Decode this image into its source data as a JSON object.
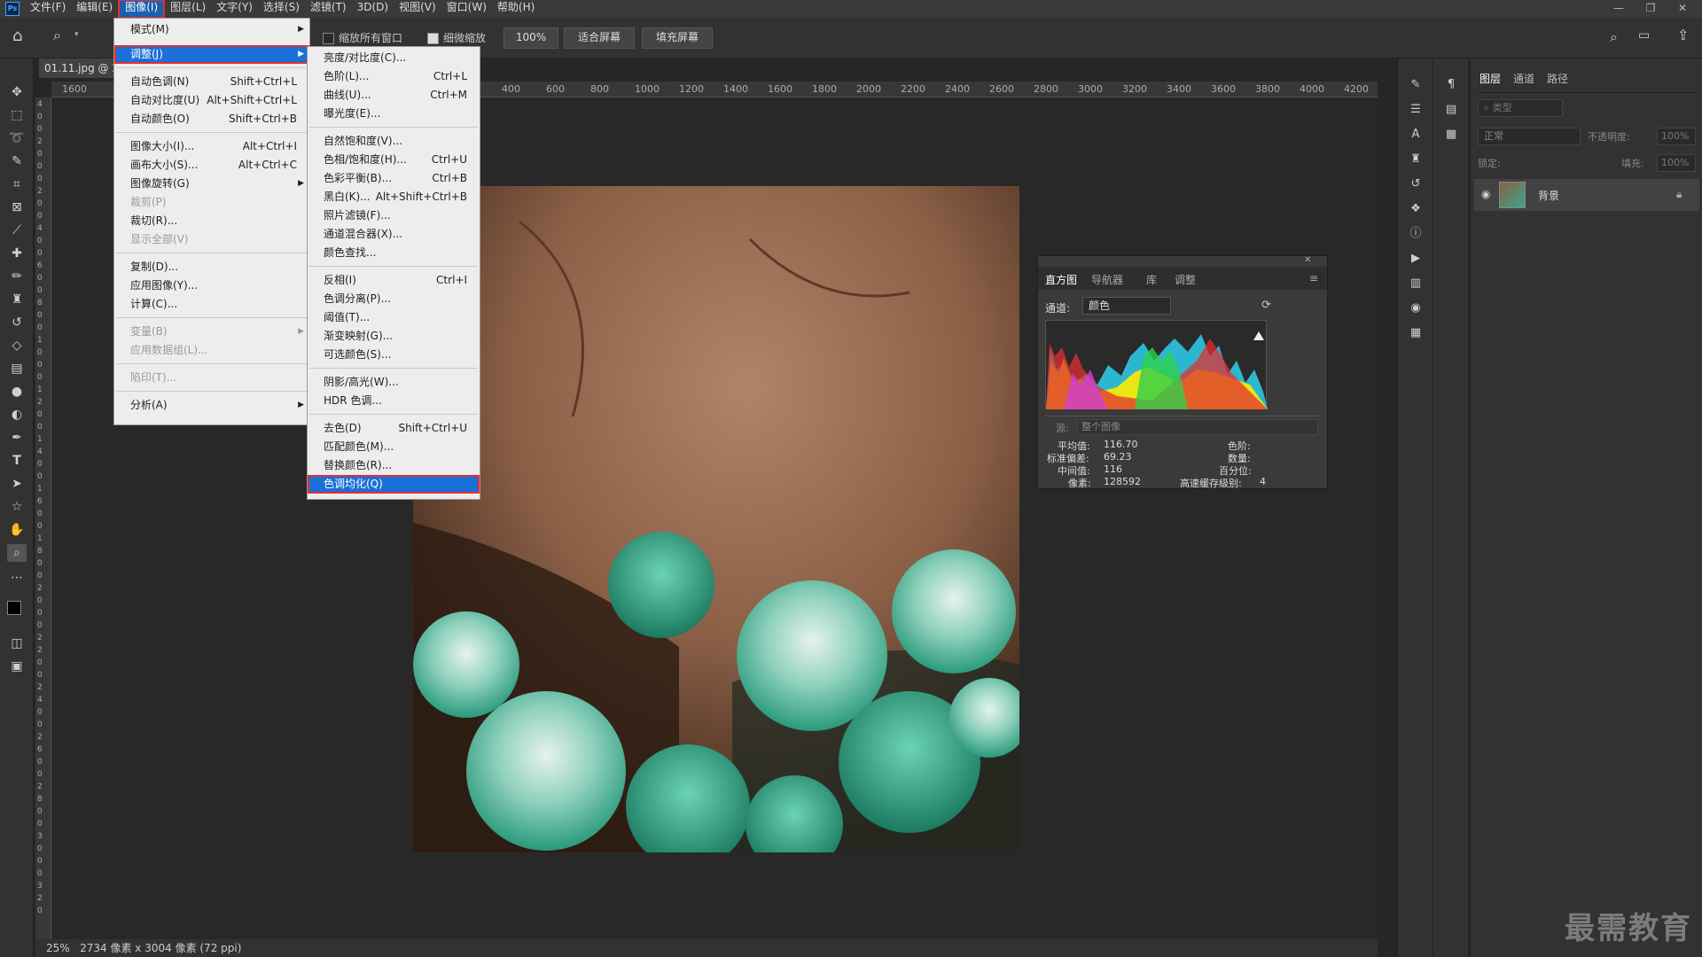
{
  "menubar": {
    "logo": "Ps",
    "items": [
      "文件(F)",
      "编辑(E)",
      "图像(I)",
      "图层(L)",
      "文字(Y)",
      "选择(S)",
      "滤镜(T)",
      "3D(D)",
      "视图(V)",
      "窗口(W)",
      "帮助(H)"
    ],
    "window_controls": [
      "—",
      "❐",
      "✕"
    ]
  },
  "options": {
    "zoom_all": "缩放所有窗口",
    "scrubby": "细微缩放",
    "zoom_100": "100%",
    "fit_screen": "适合屏幕",
    "fill_screen": "填充屏幕"
  },
  "document": {
    "tab": "01.11.jpg @ 2"
  },
  "ruler": {
    "h_ticks": [
      "1600",
      "1",
      "400",
      "600",
      "800",
      "1000",
      "1200",
      "1400",
      "1600",
      "1800",
      "2000",
      "2200",
      "2400",
      "2600",
      "2800",
      "3000",
      "3200",
      "3400",
      "3600",
      "3800",
      "4000",
      "4200"
    ],
    "v_ticks": [
      "4",
      "0",
      "0",
      "2",
      "0",
      "0",
      "0",
      "2",
      "0",
      "0",
      "4",
      "0",
      "0",
      "6",
      "0",
      "0",
      "8",
      "0",
      "0",
      "1",
      "0",
      "0",
      "0",
      "1",
      "2",
      "0",
      "0",
      "1",
      "4",
      "0",
      "0",
      "1",
      "6",
      "0",
      "0",
      "1",
      "8",
      "0",
      "0",
      "2",
      "0",
      "0",
      "0",
      "2",
      "2",
      "0",
      "0",
      "2",
      "4",
      "0",
      "0",
      "2",
      "6",
      "0",
      "0",
      "2",
      "8",
      "0",
      "0",
      "3",
      "0",
      "0",
      "0",
      "3",
      "2",
      "0"
    ]
  },
  "status": {
    "zoom": "25%",
    "info": "2734 像素 x 3004 像素 (72 ppi)"
  },
  "image_menu": [
    {
      "label": "模式(M)",
      "shortcut": "",
      "arrow": true,
      "disabled": false
    },
    {
      "label": "调整(J)",
      "shortcut": "",
      "arrow": true,
      "disabled": false,
      "highlight": true
    },
    {
      "label": "自动色调(N)",
      "shortcut": "Shift+Ctrl+L",
      "arrow": false,
      "disabled": false
    },
    {
      "label": "自动对比度(U)",
      "shortcut": "Alt+Shift+Ctrl+L",
      "arrow": false,
      "disabled": false
    },
    {
      "label": "自动颜色(O)",
      "shortcut": "Shift+Ctrl+B",
      "arrow": false,
      "disabled": false
    },
    {
      "label": "图像大小(I)...",
      "shortcut": "Alt+Ctrl+I",
      "arrow": false,
      "disabled": false
    },
    {
      "label": "画布大小(S)...",
      "shortcut": "Alt+Ctrl+C",
      "arrow": false,
      "disabled": false
    },
    {
      "label": "图像旋转(G)",
      "shortcut": "",
      "arrow": true,
      "disabled": false
    },
    {
      "label": "裁剪(P)",
      "shortcut": "",
      "arrow": false,
      "disabled": true
    },
    {
      "label": "裁切(R)...",
      "shortcut": "",
      "arrow": false,
      "disabled": false
    },
    {
      "label": "显示全部(V)",
      "shortcut": "",
      "arrow": false,
      "disabled": true
    },
    {
      "label": "复制(D)...",
      "shortcut": "",
      "arrow": false,
      "disabled": false
    },
    {
      "label": "应用图像(Y)...",
      "shortcut": "",
      "arrow": false,
      "disabled": false
    },
    {
      "label": "计算(C)...",
      "shortcut": "",
      "arrow": false,
      "disabled": false
    },
    {
      "label": "变量(B)",
      "shortcut": "",
      "arrow": true,
      "disabled": true
    },
    {
      "label": "应用数据组(L)...",
      "shortcut": "",
      "arrow": false,
      "disabled": true
    },
    {
      "label": "陷印(T)...",
      "shortcut": "",
      "arrow": false,
      "disabled": true
    },
    {
      "label": "分析(A)",
      "shortcut": "",
      "arrow": true,
      "disabled": false
    }
  ],
  "adjust_menu": [
    {
      "label": "亮度/对比度(C)...",
      "shortcut": ""
    },
    {
      "label": "色阶(L)...",
      "shortcut": "Ctrl+L"
    },
    {
      "label": "曲线(U)...",
      "shortcut": "Ctrl+M"
    },
    {
      "label": "曝光度(E)...",
      "shortcut": ""
    },
    {
      "label": "自然饱和度(V)...",
      "shortcut": ""
    },
    {
      "label": "色相/饱和度(H)...",
      "shortcut": "Ctrl+U"
    },
    {
      "label": "色彩平衡(B)...",
      "shortcut": "Ctrl+B"
    },
    {
      "label": "黑白(K)...",
      "shortcut": "Alt+Shift+Ctrl+B"
    },
    {
      "label": "照片滤镜(F)...",
      "shortcut": ""
    },
    {
      "label": "通道混合器(X)...",
      "shortcut": ""
    },
    {
      "label": "颜色查找...",
      "shortcut": ""
    },
    {
      "label": "反相(I)",
      "shortcut": "Ctrl+I"
    },
    {
      "label": "色调分离(P)...",
      "shortcut": ""
    },
    {
      "label": "阈值(T)...",
      "shortcut": ""
    },
    {
      "label": "渐变映射(G)...",
      "shortcut": ""
    },
    {
      "label": "可选颜色(S)...",
      "shortcut": ""
    },
    {
      "label": "阴影/高光(W)...",
      "shortcut": ""
    },
    {
      "label": "HDR 色调...",
      "shortcut": ""
    },
    {
      "label": "去色(D)",
      "shortcut": "Shift+Ctrl+U"
    },
    {
      "label": "匹配颜色(M)...",
      "shortcut": ""
    },
    {
      "label": "替换颜色(R)...",
      "shortcut": ""
    },
    {
      "label": "色调均化(Q)",
      "shortcut": "",
      "highlight": true
    }
  ],
  "histogram": {
    "tabs": [
      "直方图",
      "导航器",
      "库",
      "调整"
    ],
    "channel_label": "通道:",
    "channel_value": "颜色",
    "source_label": "源:",
    "source_value": "整个图像",
    "mean_label": "平均值:",
    "mean": "116.70",
    "std_label": "标准偏差:",
    "std": "69.23",
    "median_label": "中间值:",
    "median": "116",
    "pixels_label": "像素:",
    "pixels": "128592",
    "level_label": "色阶:",
    "count_label": "数量:",
    "percentile_label": "百分位:",
    "cache_label": "高速缓存级别:",
    "cache": "4"
  },
  "layers": {
    "tabs": [
      "图层",
      "通道",
      "路径"
    ],
    "filter_placeholder": "类型",
    "blend_mode": "正常",
    "opacity_label": "不透明度:",
    "opacity": "100%",
    "lock_label": "锁定:",
    "fill_label": "填充:",
    "fill": "100%",
    "layer_name": "背景"
  },
  "watermark": "最需教育"
}
